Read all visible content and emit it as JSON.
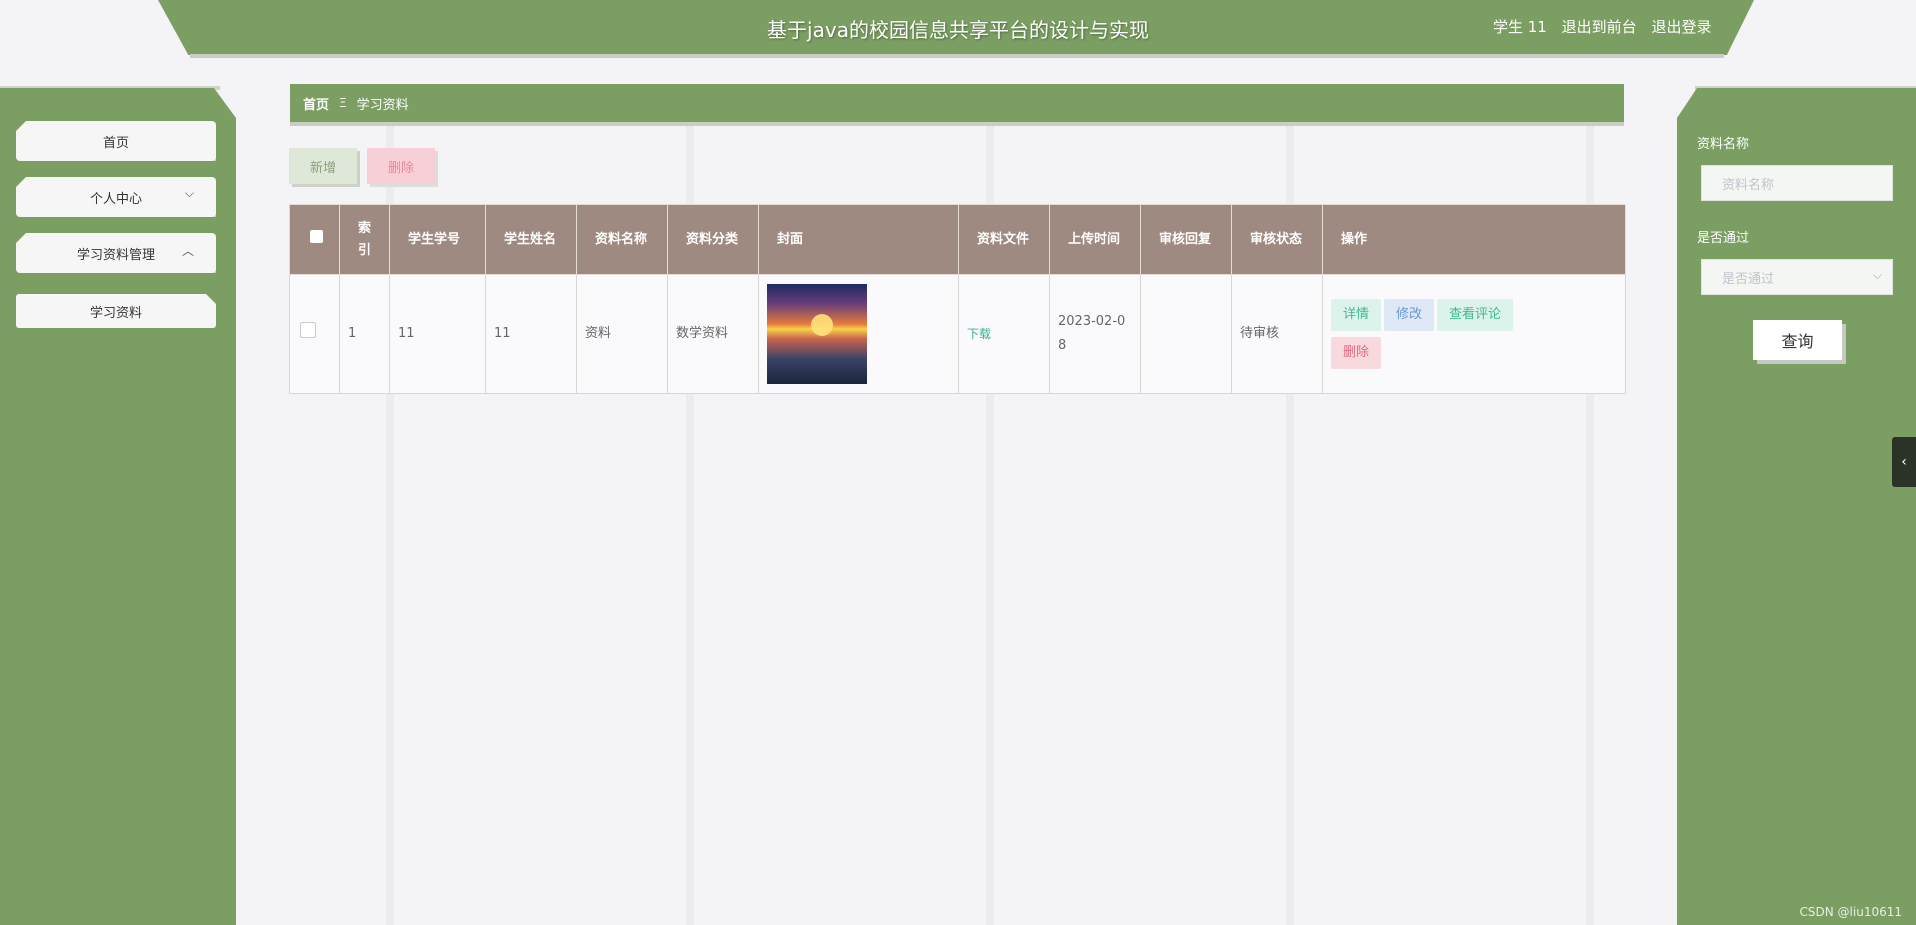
{
  "header": {
    "title": "基于java的校园信息共享平台的设计与实现",
    "user_label": "学生 11",
    "to_front_label": "退出到前台",
    "logout_label": "退出登录"
  },
  "sidebar": {
    "items": [
      {
        "label": "首页"
      },
      {
        "label": "个人中心",
        "icon": "chevron-down-icon"
      },
      {
        "label": "学习资料管理",
        "icon": "chevron-up-icon"
      }
    ],
    "submenu": [
      {
        "label": "学习资料"
      }
    ]
  },
  "breadcrumb": {
    "home": "首页",
    "separator": "Ξ",
    "current": "学习资料"
  },
  "actions": {
    "add_label": "新增",
    "delete_label": "删除"
  },
  "table": {
    "headers": [
      "索引",
      "学生学号",
      "学生姓名",
      "资料名称",
      "资料分类",
      "封面",
      "资料文件",
      "上传时间",
      "审核回复",
      "审核状态",
      "操作"
    ],
    "rows": [
      {
        "index": "1",
        "student_no": "11",
        "student_name": "11",
        "name": "资料",
        "category": "数学资料",
        "file_label": "下载",
        "upload_time": "2023-02-08",
        "reply": "",
        "status": "待审核",
        "ops": {
          "detail": "详情",
          "edit": "修改",
          "comments": "查看评论",
          "delete": "删除"
        }
      }
    ]
  },
  "search": {
    "name_label": "资料名称",
    "name_placeholder": "资料名称",
    "pass_label": "是否通过",
    "pass_placeholder": "是否通过",
    "query_label": "查询"
  },
  "watermark": "CSDN @liu10611",
  "colors": {
    "primary": "#7b9f62",
    "table_header": "#9e8a80",
    "background": "#f4f3f6"
  }
}
